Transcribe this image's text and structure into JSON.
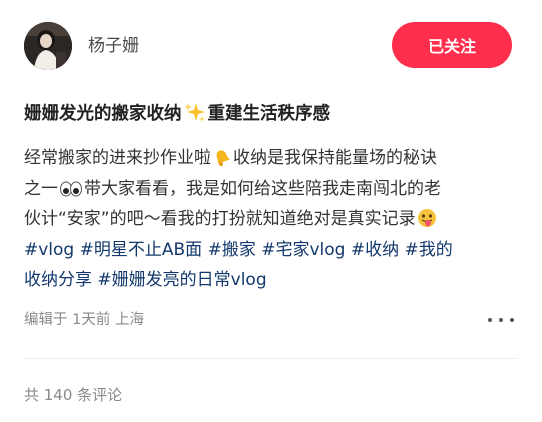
{
  "author": {
    "name": "杨子姗",
    "avatar_icon": "user-avatar"
  },
  "follow_button": {
    "label": "已关注",
    "color": "#ff2e4d"
  },
  "post": {
    "title_part1": "姗姗发光的搬家收纳",
    "title_emoji": "sparkles-emoji",
    "title_part2": "重建生活秩序感",
    "line1_a": "经常搬家的进来抄作业啦",
    "line1_emoji": "bell-emoji",
    "line1_b": "收纳是我保持能量场的秘诀",
    "line2_a": "之一",
    "line2_emoji": "eyes-emoji",
    "line2_b": "带大家看看，我是如何给这些陪我走南闯北的老",
    "line3_a": "伙计“安家”的吧～看我的打扮就知道绝对是真实记录",
    "line3_emoji": "tongue-out-emoji",
    "hashtags_line4": [
      "#vlog",
      "#明星不止AB面",
      "#搬家",
      "#宅家vlog",
      "#收纳",
      "#我的"
    ],
    "hashtags_line5": [
      "收纳分享",
      "#姗姗发亮的日常vlog"
    ],
    "hashtag_color": "#13386c"
  },
  "meta": {
    "text": "编辑于 1天前 上海",
    "more_icon": "more-dots-icon"
  },
  "comments": {
    "count_text": "共 140 条评论"
  }
}
